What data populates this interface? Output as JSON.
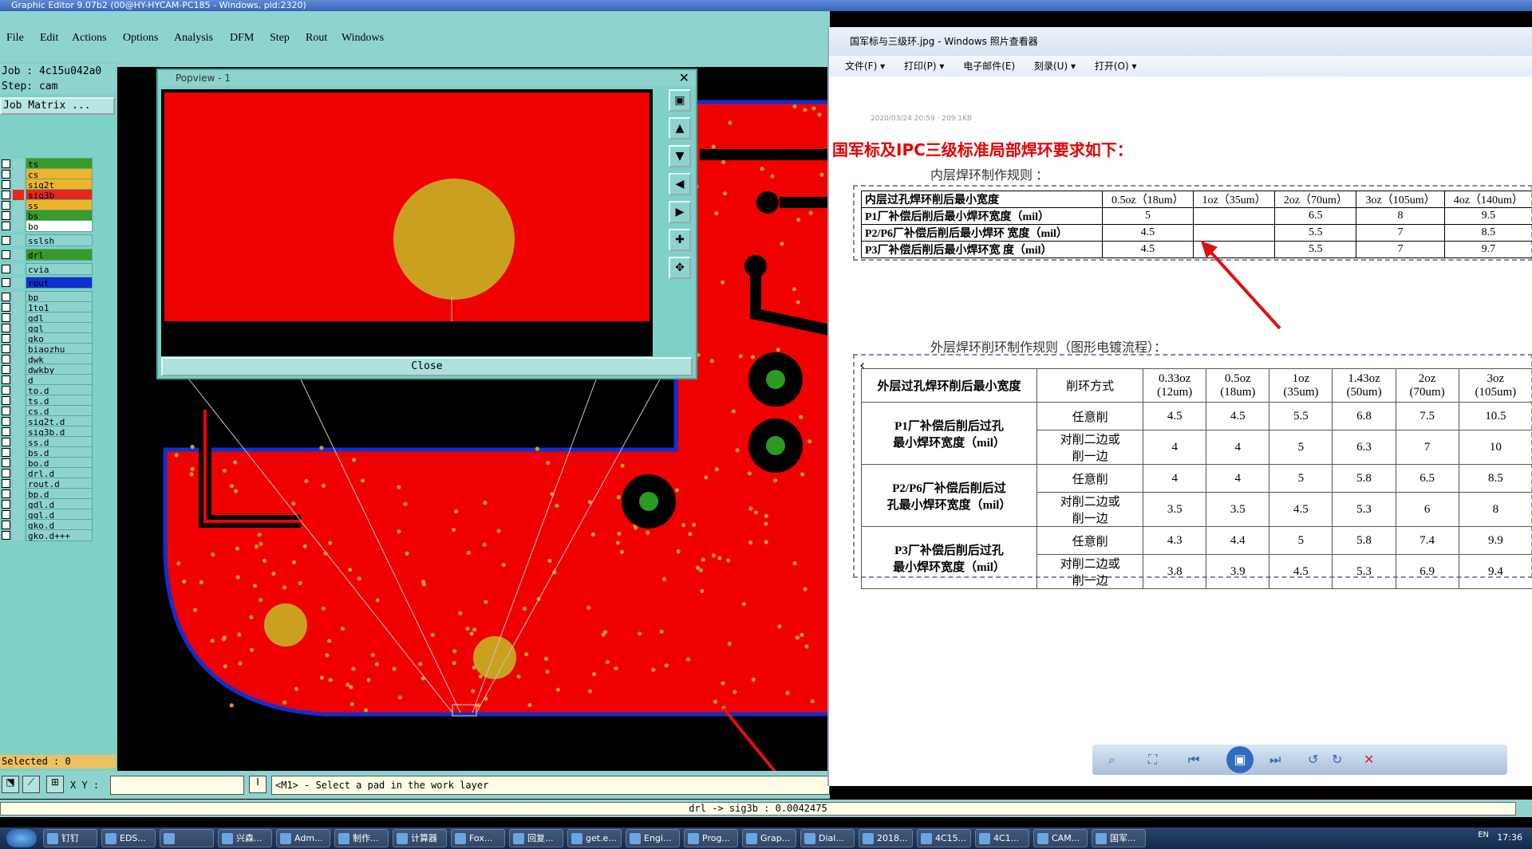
{
  "genesis": {
    "title": "Graphic Editor 9.07b2 (00@HY-HYCAM-PC185 - Windows, pid:2320)",
    "menu": [
      "File",
      "Edit",
      "Actions",
      "Options",
      "Analysis",
      "DFM",
      "Step",
      "Rout",
      "Windows"
    ],
    "job_label": "Job : 4c15u042a0",
    "step_label": "Step: cam",
    "job_matrix": "Job Matrix ...",
    "selected": "Selected : 0",
    "xy_label": "X Y :",
    "status_message": "<M1> - Select a pad in the work layer",
    "measurement": "drl -> sig3b : 0.0042475",
    "layers": [
      {
        "name": "ts",
        "color": "#3a9a2a"
      },
      {
        "name": "cs",
        "color": "#f0b428"
      },
      {
        "name": "sig2t",
        "color": "#f0b428"
      },
      {
        "name": "sig3b",
        "color": "#e8261a",
        "work": true
      },
      {
        "name": "ss",
        "color": "#f0b428"
      },
      {
        "name": "bs",
        "color": "#3a9a2a"
      },
      {
        "name": "bo",
        "color": "#ffffff"
      },
      {
        "name": "sslsh",
        "color": "#8fd3cf"
      },
      {
        "name": "drl",
        "color": "#3a9a2a"
      },
      {
        "name": "cvia",
        "color": "#8fd3cf"
      },
      {
        "name": "rout",
        "color": "#1030d0"
      },
      {
        "name": "bp"
      },
      {
        "name": "1to1"
      },
      {
        "name": "gdl"
      },
      {
        "name": "ggl"
      },
      {
        "name": "gko"
      },
      {
        "name": "biaozhu"
      },
      {
        "name": "dwk"
      },
      {
        "name": "dwkby"
      },
      {
        "name": "d"
      },
      {
        "name": "to.d"
      },
      {
        "name": "ts.d"
      },
      {
        "name": "cs.d"
      },
      {
        "name": "sig2t.d"
      },
      {
        "name": "sig3b.d"
      },
      {
        "name": "ss.d"
      },
      {
        "name": "bs.d"
      },
      {
        "name": "bo.d"
      },
      {
        "name": "drl.d"
      },
      {
        "name": "rout.d"
      },
      {
        "name": "bp.d"
      },
      {
        "name": "gdl.d"
      },
      {
        "name": "ggl.d"
      },
      {
        "name": "gko.d"
      },
      {
        "name": "gko.d+++"
      }
    ]
  },
  "popview": {
    "title": "Popview - 1",
    "close_label": "Close"
  },
  "viewer": {
    "title": "国军标与三级环.jpg - Windows 照片查看器",
    "menu": [
      "文件(F) ▾",
      "打印(P) ▾",
      "电子邮件(E)",
      "刻录(U) ▾",
      "打开(O) ▾"
    ],
    "meta": "2020/03/24 20:59 · 209.1KB",
    "heading": "国军标及IPC三级标准局部焊环要求如下：",
    "inner_title": "内层焊环制作规则 ：",
    "inner_table": {
      "headers": [
        "内层过孔焊环削后最小宽度",
        "0.5oz（18um）",
        "1oz（35um）",
        "2oz（70um）",
        "3oz（105um）",
        "4oz（140um）"
      ],
      "rows": [
        [
          "P1厂补偿后削后最小焊环宽度（mil）",
          "5",
          "",
          "6.5",
          "8",
          "9.5"
        ],
        [
          "P2/P6厂补偿后削后最小焊环 宽度（mil）",
          "4.5",
          "",
          "5.5",
          "7",
          "8.5"
        ],
        [
          "P3厂补偿后削后最小焊环宽 度（mil）",
          "4.5",
          "",
          "5.5",
          "7",
          "9.7"
        ]
      ]
    },
    "outer_title": "外层焊环削环制作规则（图形电镀流程）：",
    "outer_table": {
      "headers": [
        "外层过孔焊环削后最小宽度",
        "削环方式",
        "0.33oz\n(12um)",
        "0.5oz\n(18um)",
        "1oz\n(35um)",
        "1.43oz\n(50um)",
        "2oz\n(70um)",
        "3oz\n(105um)"
      ],
      "groups": [
        {
          "label": "P1厂补偿后削后过孔\n最小焊环宽度（mil）",
          "rows": [
            [
              "任意削",
              "4.5",
              "4.5",
              "5.5",
              "6.8",
              "7.5",
              "10.5"
            ],
            [
              "对削二边或\n削一边",
              "4",
              "4",
              "5",
              "6.3",
              "7",
              "10"
            ]
          ]
        },
        {
          "label": "P2/P6厂补偿后削后过\n孔最小焊环宽度（mil）",
          "rows": [
            [
              "任意削",
              "4",
              "4",
              "5",
              "5.8",
              "6.5",
              "8.5"
            ],
            [
              "对削二边或\n削一边",
              "3.5",
              "3.5",
              "4.5",
              "5.3",
              "6",
              "8"
            ]
          ]
        },
        {
          "label": "P3厂补偿后削后过孔\n最小焊环宽度（mil）",
          "rows": [
            [
              "任意削",
              "4.3",
              "4.4",
              "5",
              "5.8",
              "7.4",
              "9.9"
            ],
            [
              "对削二边或\n削一边",
              "3.8",
              "3.9",
              "4.5",
              "5.3",
              "6.9",
              "9.4"
            ]
          ]
        }
      ]
    }
  },
  "taskbar": {
    "clock": "17:36",
    "lang": "EN",
    "items": [
      "钉钉",
      "EDS...",
      "",
      "兴森...",
      "Adm...",
      "制作...",
      "计算器",
      "Fox...",
      "回复...",
      "get.e...",
      "Engi...",
      "Prog...",
      "Grap...",
      "Dial...",
      "2018...",
      "4C15...",
      "4C1...",
      "CAM...",
      "国军..."
    ]
  },
  "colors": {
    "board_red": "#f00000",
    "pad_gold": "#c9a020",
    "board_outline": "#1030d0",
    "panel": "#8fd3cf"
  }
}
